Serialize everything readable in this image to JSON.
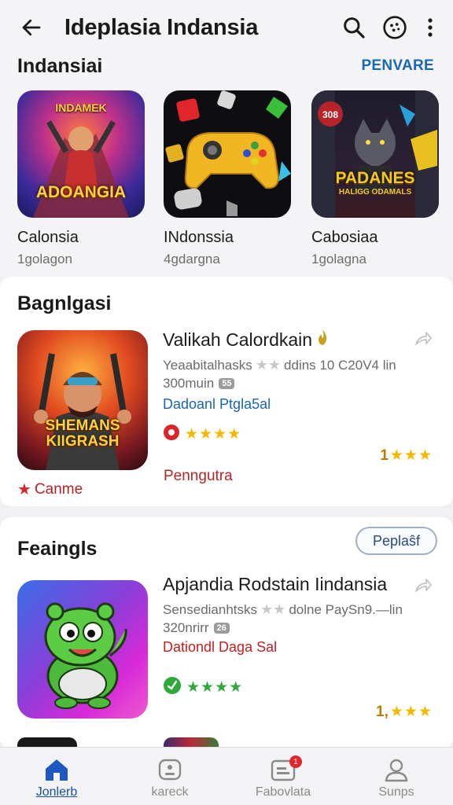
{
  "header": {
    "title": "Ideplasia Indansia",
    "back_icon": "arrow-left-icon",
    "search_icon": "search-icon",
    "profile_icon": "dots-circle-icon",
    "menu_icon": "more-vert-icon"
  },
  "section1": {
    "title": "Indansiai",
    "more": "PENVARE",
    "items": [
      {
        "art_text_top": "INDAMEK",
        "art_text": "ADOANGIA",
        "name": "Calonsia",
        "meta": "1golagon"
      },
      {
        "name": "INdonssia",
        "meta": "4gdargna"
      },
      {
        "art_badge": "308",
        "art_text": "PADANES",
        "art_sub": "HALIGG ODAMALS",
        "name": "Cabosiaa",
        "meta": "1golagna"
      }
    ]
  },
  "section2": {
    "title": "Bagnlgasi",
    "app": {
      "art_text": "SHEMANS KIIGRASH",
      "title": "Valikah Calordkain",
      "desc_left": "Yeaabitalhasks",
      "desc_right": "ddins 10 C20V4  lin",
      "size": "300muin",
      "size_chip": "55",
      "tag": "Dadoanl Ptgla5al",
      "tag_color": "#1a64b8",
      "stars": "★★★★",
      "right_rating": "1",
      "right_stars": "★★★",
      "category_label": "Canme",
      "sub_label": "Penngutra"
    }
  },
  "section3": {
    "title": "Feaingls",
    "button": "Peplaŝf",
    "app": {
      "title": "Apjandia Rodstain Iindansia",
      "desc_left": "Sensedianhtsks",
      "desc_right": "dolne PaySn9.—lin",
      "size": "320nrirr",
      "size_chip": "26",
      "tag": "Dationdl Dagа Sal",
      "tag_color": "#c41e1e",
      "stars": "★★★★",
      "right_rating": "1,",
      "right_stars": "★★★"
    }
  },
  "bottom_nav": [
    {
      "label": "Jonlerb",
      "icon": "home-icon",
      "active": true
    },
    {
      "label": "kareck",
      "icon": "robot-icon",
      "active": false
    },
    {
      "label": "Fabovlata",
      "icon": "inbox-icon",
      "active": false,
      "badge": "1"
    },
    {
      "label": "Sunps",
      "icon": "person-icon",
      "active": false
    }
  ],
  "colors": {
    "accent": "#1a67b4",
    "star": "#f5b800",
    "badge": "#e0272b"
  }
}
